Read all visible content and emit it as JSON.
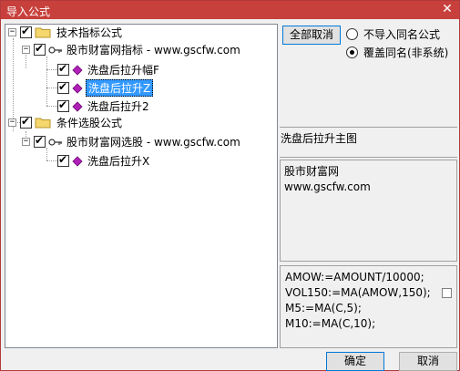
{
  "window": {
    "title": "导入公式",
    "close_glyph": "✕"
  },
  "tree": {
    "technical": {
      "label": "技术指标公式",
      "checked": true,
      "expanded": true
    },
    "tech_source": {
      "label": "股市财富网指标 - www.gscfw.com",
      "checked": true,
      "expanded": true
    },
    "tech_items": [
      {
        "label": "洗盘后拉升幅F",
        "checked": true,
        "selected": false
      },
      {
        "label": "洗盘后拉升Z",
        "checked": true,
        "selected": true
      },
      {
        "label": "洗盘后拉升2",
        "checked": true,
        "selected": false
      }
    ],
    "screening": {
      "label": "条件选股公式",
      "checked": true,
      "expanded": true
    },
    "screen_source": {
      "label": "股市财富网选股 - www.gscfw.com",
      "checked": true,
      "expanded": true
    },
    "screen_items": [
      {
        "label": "洗盘后拉升X",
        "checked": true,
        "selected": false
      }
    ],
    "expander_glyph": "−",
    "check_glyph": "✔"
  },
  "controls": {
    "cancel_all_label": "全部取消",
    "options": [
      {
        "label": "不导入同名公式",
        "selected": false
      },
      {
        "label": "覆盖同名(非系统)",
        "selected": true
      }
    ]
  },
  "detail": {
    "formula_name": "洗盘后拉升主图",
    "description": [
      "股市财富网",
      "www.gscfw.com"
    ],
    "code": [
      "AMOW:=AMOUNT/10000;",
      "VOL150:=MA(AMOW,150);",
      "M5:=MA(C,5);",
      "M10:=MA(C,10);"
    ]
  },
  "footer": {
    "ok_label": "确定",
    "cancel_label": "取消"
  },
  "colors": {
    "titlebar": "#c8403c",
    "selection": "#3399ff",
    "folder": "#f5d76e",
    "diamond": "#b01fb8"
  }
}
